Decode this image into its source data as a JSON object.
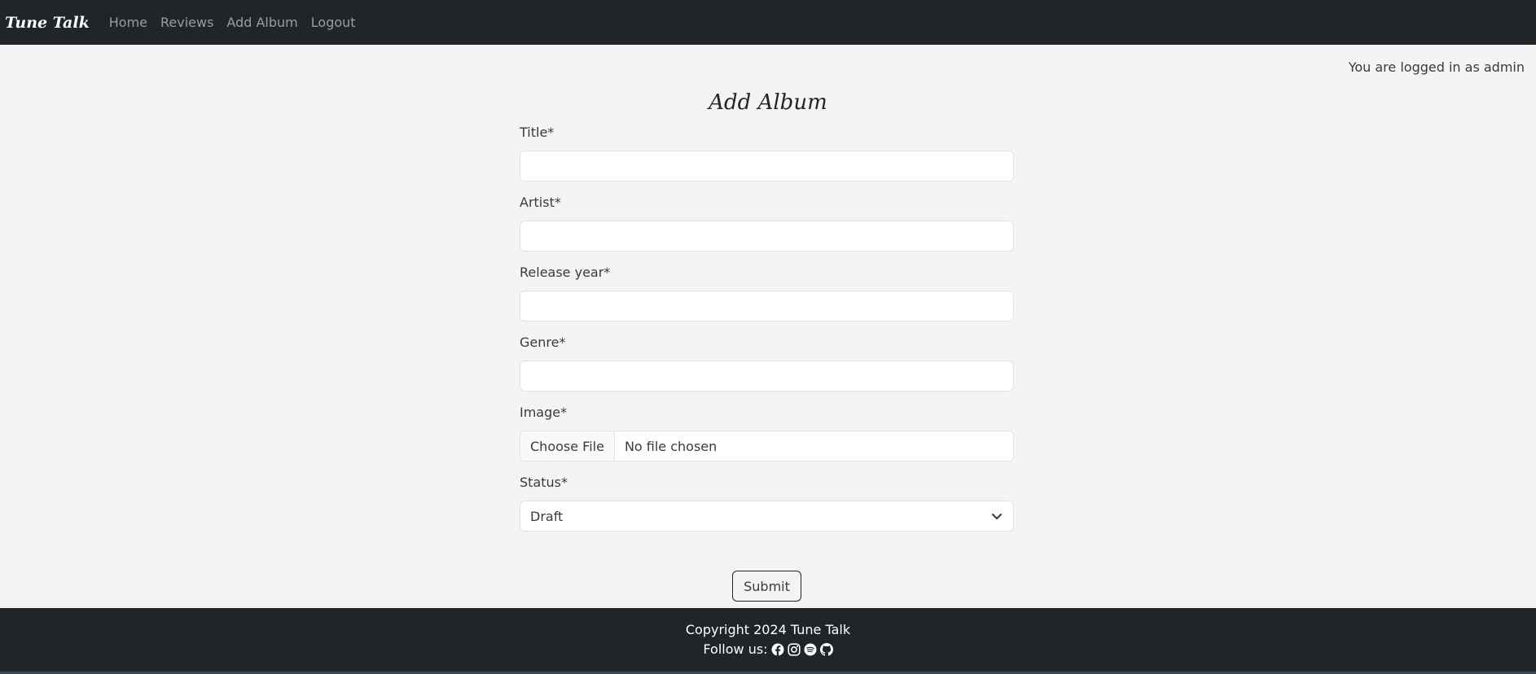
{
  "nav": {
    "brand": "Tune Talk",
    "links": [
      "Home",
      "Reviews",
      "Add Album",
      "Logout"
    ]
  },
  "login_status": "You are logged in as admin",
  "page_title": "Add Album",
  "form": {
    "fields": [
      {
        "label": "Title*",
        "value": ""
      },
      {
        "label": "Artist*",
        "value": ""
      },
      {
        "label": "Release year*",
        "value": ""
      },
      {
        "label": "Genre*",
        "value": ""
      }
    ],
    "image": {
      "label": "Image*",
      "button": "Choose File",
      "status": "No file chosen"
    },
    "status": {
      "label": "Status*",
      "selected": "Draft"
    },
    "submit": "Submit"
  },
  "footer": {
    "copyright": "Copyright 2024 Tune Talk",
    "follow": "Follow us:",
    "social_icons": [
      "facebook-icon",
      "instagram-icon",
      "spotify-icon",
      "github-icon"
    ]
  },
  "colors": {
    "navbar_bg": "#212529",
    "page_bg": "#f4f4f4",
    "text": "#3a3a3a"
  }
}
